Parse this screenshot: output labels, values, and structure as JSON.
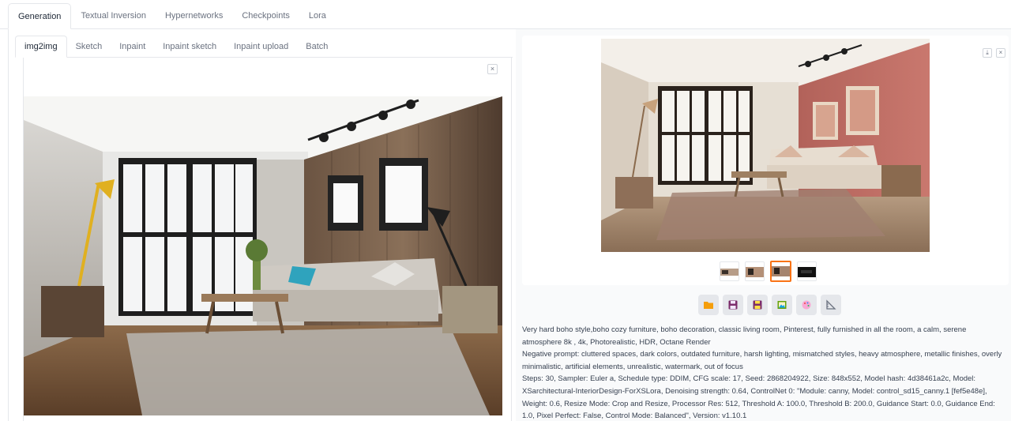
{
  "top_tabs": [
    "Generation",
    "Textual Inversion",
    "Hypernetworks",
    "Checkpoints",
    "Lora"
  ],
  "sub_tabs": [
    "img2img",
    "Sketch",
    "Inpaint",
    "Inpaint sketch",
    "Inpaint upload",
    "Batch"
  ],
  "input_image": {
    "close_icon": "close-icon"
  },
  "gallery": {
    "download_icon": "download-icon",
    "close_icon": "close-icon",
    "thumbnail_count": 4,
    "selected_index": 2
  },
  "toolbar": {
    "icons": [
      "folder-icon",
      "save-icon",
      "zip-icon",
      "image-icon",
      "palette-icon",
      "ruler-icon"
    ],
    "colors": [
      "#f59e0b",
      "#7c2d6b",
      "#7c2d6b",
      "#65a30d",
      "#ec4899",
      "#6b7280"
    ]
  },
  "generation_info": {
    "prompt": "Very hard boho style,boho cozy furniture, boho decoration, classic living room, Pinterest, fully furnished in all the room, a calm, serene atmosphere 8k , 4k, Photorealistic, HDR, Octane Render",
    "negative_prompt": "Negative prompt: cluttered spaces, dark colors, outdated furniture, harsh lighting, mismatched styles, heavy atmosphere, metallic finishes, overly minimalistic, artificial elements, unrealistic, watermark, out of focus",
    "params": "Steps: 30, Sampler: Euler a, Schedule type: DDIM, CFG scale: 17, Seed: 2868204922, Size: 848x552, Model hash: 4d38461a2c, Model: XSarchitectural-InteriorDesign-ForXSLora, Denoising strength: 0.64, ControlNet 0: \"Module: canny, Model: control_sd15_canny.1 [fef5e48e], Weight: 0.6, Resize Mode: Crop and Resize, Processor Res: 512, Threshold A: 100.0, Threshold B: 200.0, Guidance Start: 0.0, Guidance End: 1.0, Pixel Perfect: False, Control Mode: Balanced\", Version: v1.10.1"
  },
  "colors": {
    "accent": "#f97316",
    "border": "#e5e7eb",
    "text": "#374151",
    "muted": "#6b7280"
  }
}
